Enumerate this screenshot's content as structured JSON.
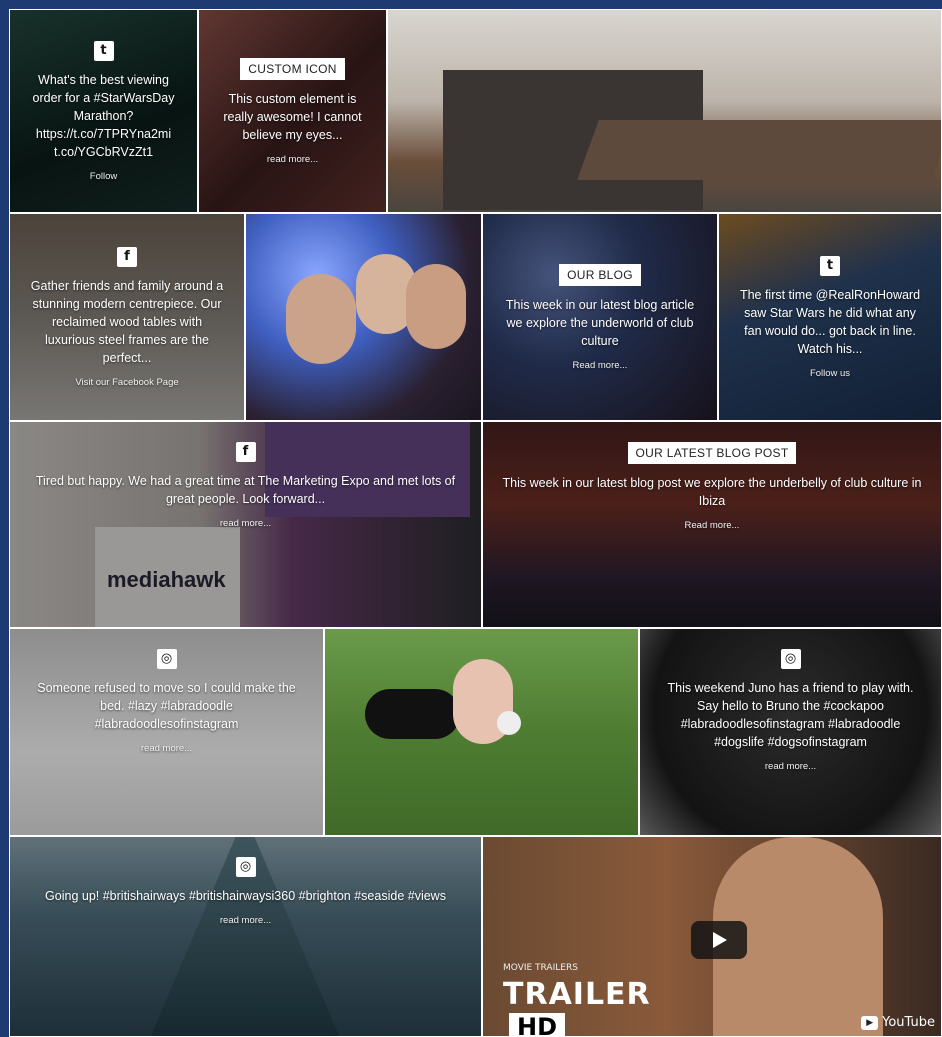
{
  "tiles": [
    {
      "icon": "twitter-icon",
      "glyph": "t",
      "text": "What's the best viewing order for a #StarWarsDay Marathon? https://t.co/7TPRYna2mi t.co/YGCbRVzZt1",
      "link": "Follow",
      "bg": "#1b3b34"
    },
    {
      "badge": "CUSTOM ICON",
      "text": "This custom element is really awesome! I cannot believe my eyes...",
      "link": "read more...",
      "bg": "#6d3a3a"
    },
    {
      "text": "",
      "link": "",
      "bg": "#8a7b6e"
    },
    {
      "icon": "facebook-icon",
      "glyph": "f",
      "text": "Gather friends and family around a stunning modern centrepiece. Our reclaimed wood tables with luxurious steel frames are the perfect...",
      "link": "Visit our Facebook Page",
      "bg": "#6b6560"
    },
    {
      "text": "",
      "link": "",
      "bg": "#3e4e8a"
    },
    {
      "badge": "OUR BLOG",
      "text": "This week in our latest blog article we explore the underworld of club culture",
      "link": "Read more...",
      "bg": "#3b4f86"
    },
    {
      "icon": "twitter-icon",
      "glyph": "t",
      "text": "The first time @RealRonHoward saw Star Wars he did what any fan would do... got back in line. Watch his...",
      "link": "Follow us",
      "bg": "#2b4b78"
    },
    {
      "icon": "facebook-icon",
      "glyph": "f",
      "text": "Tired but happy. We had a great time at The Marketing Expo and met lots of great people. Look forward...",
      "link": "read more...",
      "bg": "#5a5360",
      "brand": "mediahawk"
    },
    {
      "badge": "OUR LATEST BLOG POST",
      "text": "This week in our latest blog post we explore the underbelly of club culture in Ibiza",
      "link": "Read more...",
      "bg": "#4a2a2a"
    },
    {
      "icon": "instagram-icon",
      "glyph": "◎",
      "text": "Someone refused to move so I could make the bed. #lazy #labradoodle #labradoodlesofinstagram",
      "link": "read more...",
      "bg": "#8f8f8f"
    },
    {
      "text": "",
      "link": "",
      "bg": "#4f7a35"
    },
    {
      "icon": "instagram-icon",
      "glyph": "◎",
      "text": "This weekend Juno has a friend to play with. Say hello to Bruno the #cockapoo #labradoodlesofinstagram #labradoodle #dogslife #dogsofinstagram",
      "link": "read more...",
      "bg": "#2b2b2b"
    },
    {
      "icon": "instagram-icon",
      "glyph": "◎",
      "text": "Going up! #britishairways #britishairwaysi360 #brighton #seaside #views",
      "link": "read more...",
      "bg": "#3f5d6e"
    },
    {
      "video": true,
      "bg": "#5a3a2a",
      "trailer_small": "MOVIE TRAILERS",
      "trailer": "TRAILER",
      "hd": "HD",
      "yt": "YouTube"
    }
  ]
}
